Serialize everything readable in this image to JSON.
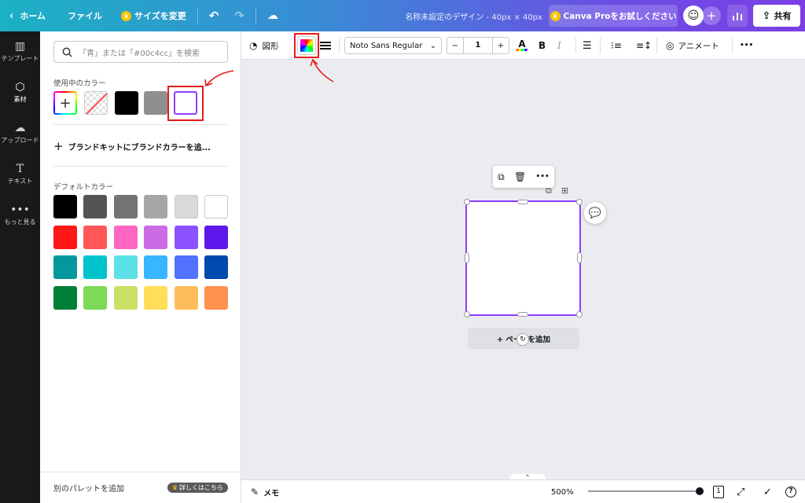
{
  "topbar": {
    "home_label": "ホーム",
    "file_label": "ファイル",
    "resize_label": "サイズを変更",
    "design_title": "名称未設定のデザイン - 40px × 40px",
    "pro_label": "Canva Proをお試しください",
    "share_label": "共有"
  },
  "rail": {
    "items": [
      {
        "label": "テンプレート"
      },
      {
        "label": "素材"
      },
      {
        "label": "アップロード"
      },
      {
        "label": "テキスト"
      },
      {
        "label": "もっと見る"
      }
    ]
  },
  "panel": {
    "search_placeholder": "「青」または「#00c4cc」を検索",
    "used_colors_label": "使用中のカラー",
    "used_colors": [
      "#000000",
      "#8f8f8f",
      "#ffffff"
    ],
    "brandkit_label": "ブランドキットにブランドカラーを追...",
    "default_colors_label": "デフォルトカラー",
    "default_colors": [
      [
        "#000000",
        "#545454",
        "#737373",
        "#a6a6a6",
        "#d9d9d9",
        "#ffffff"
      ],
      [
        "#ff1616",
        "#ff5757",
        "#ff66c4",
        "#cb6ce6",
        "#8c52ff",
        "#5e17eb"
      ],
      [
        "#03989e",
        "#00c2cb",
        "#5ce1e6",
        "#38b6ff",
        "#5271ff",
        "#004aad"
      ],
      [
        "#008037",
        "#7ed957",
        "#c9e265",
        "#ffde59",
        "#ffbd59",
        "#ff914d"
      ]
    ],
    "footer_label": "別のパレットを追加",
    "footer_badge": "詳しくはこちら"
  },
  "toolbar": {
    "shape_label": "図形",
    "font_name": "Noto Sans Regular",
    "stepper_minus": "−",
    "font_size": "1",
    "stepper_plus": "+",
    "bold_label": "B",
    "italic_label": "I",
    "animate_label": "アニメート",
    "more_label": "•••"
  },
  "canvas": {
    "add_page_label": "+ ページを追加"
  },
  "bottombar": {
    "memo_label": "メモ",
    "zoom_label": "500%",
    "page_count": "1"
  },
  "accent_color": "#8b3dff",
  "annotation_color": "#e41c1c"
}
